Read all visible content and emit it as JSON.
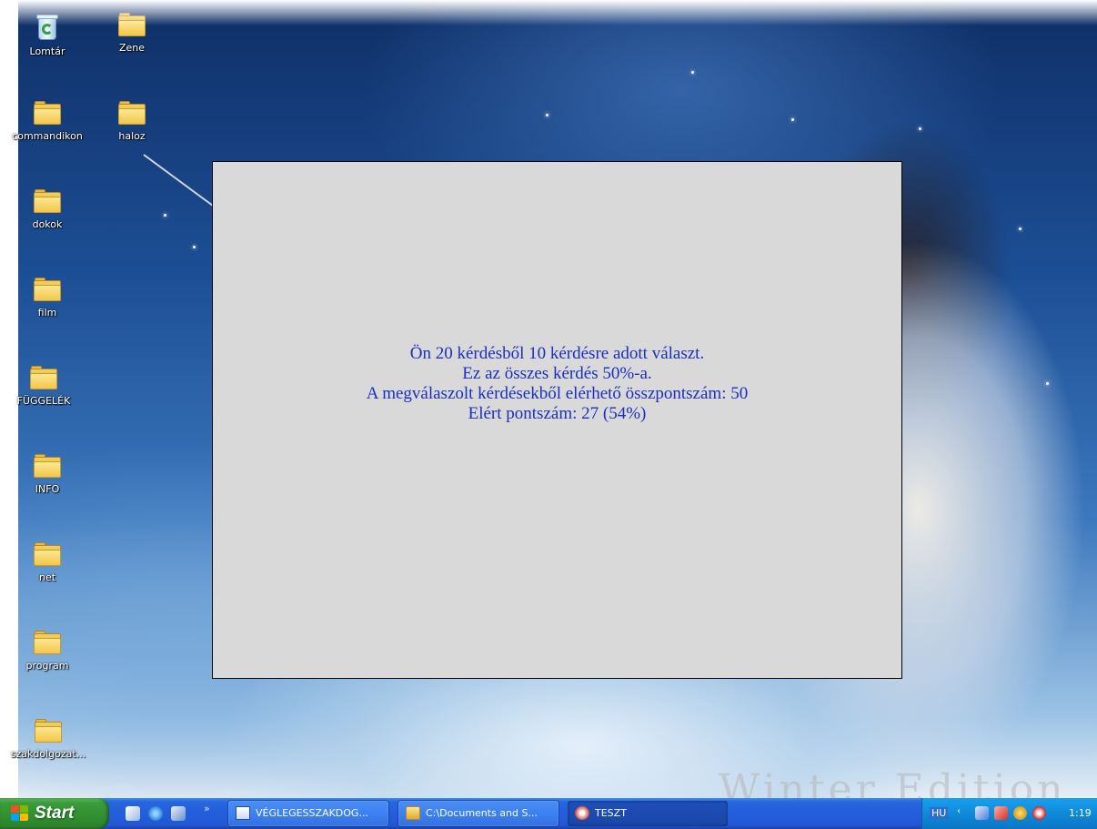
{
  "desktop": {
    "icons": [
      {
        "label": "Lomtár",
        "icon": "recycle-bin-icon"
      },
      {
        "label": "Zene",
        "icon": "folder-icon"
      },
      {
        "label": "commandikon",
        "icon": "folder-icon"
      },
      {
        "label": "haloz",
        "icon": "folder-icon"
      },
      {
        "label": "dokok",
        "icon": "folder-icon"
      },
      {
        "label": "film",
        "icon": "folder-icon"
      },
      {
        "label": "FÜGGELÉK",
        "icon": "folder-icon"
      },
      {
        "label": "INFO",
        "icon": "folder-icon"
      },
      {
        "label": "net",
        "icon": "folder-icon"
      },
      {
        "label": "program",
        "icon": "folder-icon"
      },
      {
        "label": "szakdolgozat...",
        "icon": "folder-icon"
      }
    ],
    "wallpaper_watermark": "Winter Edition"
  },
  "dialog": {
    "lines": [
      "Ön 20 kérdésből 10 kérdésre adott választ.",
      "Ez az összes kérdés 50%-a.",
      "A megválaszolt kérdésekből elérhető összpontszám: 50",
      "Elért pontszám: 27 (54%)"
    ],
    "background_color": "#d9d9d9",
    "text_color": "#1a2fc0"
  },
  "taskbar": {
    "start_label": "Start",
    "quick_launch": [
      "show-desktop-icon",
      "internet-explorer-icon",
      "windows-media-icon"
    ],
    "quick_launch_more": "»",
    "tasks": [
      {
        "label": "VÉGLEGESSZAKDOG...",
        "icon": "word-document-icon"
      },
      {
        "label": "C:\\Documents and S...",
        "icon": "folder-icon"
      },
      {
        "label": "TESZT",
        "icon": "app-icon"
      }
    ],
    "tray": {
      "language": "HU",
      "expand": "‹",
      "icons": [
        "network-icon",
        "acrobat-icon",
        "antivirus-icon",
        "shield-icon"
      ],
      "clock": "1:19"
    }
  }
}
